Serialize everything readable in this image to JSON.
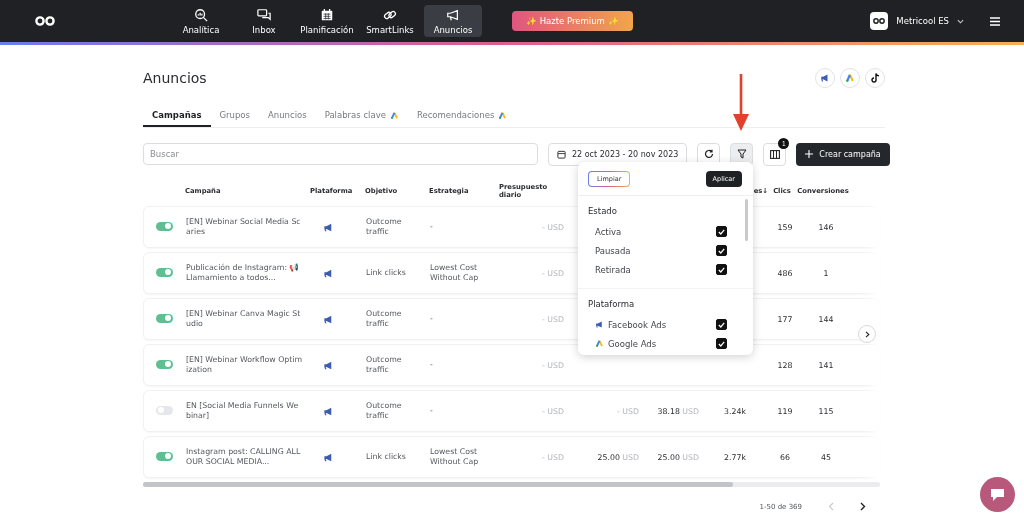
{
  "nav": {
    "items": [
      {
        "label": "Analítica",
        "selected": false
      },
      {
        "label": "Inbox",
        "selected": false
      },
      {
        "label": "Planificación",
        "selected": false
      },
      {
        "label": "SmartLinks",
        "selected": false
      },
      {
        "label": "Anuncios",
        "selected": true
      }
    ],
    "premium_button": "✨ Hazte Premium ✨",
    "account": "Metricool ES"
  },
  "page": {
    "title": "Anuncios"
  },
  "tabs": [
    {
      "label": "Campañas",
      "selected": true,
      "google_badge": false
    },
    {
      "label": "Grupos",
      "selected": false,
      "google_badge": false
    },
    {
      "label": "Anuncios",
      "selected": false,
      "google_badge": false
    },
    {
      "label": "Palabras clave",
      "selected": false,
      "google_badge": true
    },
    {
      "label": "Recomendaciones",
      "selected": false,
      "google_badge": true
    }
  ],
  "toolbar": {
    "search_placeholder": "Buscar",
    "date_range": "22 oct 2023 - 20 nov 2023",
    "columns_badge": "1",
    "create_button": "Crear campaña"
  },
  "table": {
    "columns": {
      "campaign": "Campaña",
      "platform": "Plataforma",
      "objective": "Objetivo",
      "strategy": "Estrategia",
      "daily_budget": "Presupuesto diario",
      "column_9": "es↓",
      "clicks": "Clics",
      "conversions": "Conversiones"
    },
    "rows": [
      {
        "active": true,
        "campaign": "[EN] Webinar Social Media Scaries",
        "objective": "Outcome traffic",
        "strategy": "-",
        "daily_budget": {
          "amount": "-",
          "currency": "USD"
        },
        "clicks": "159",
        "conversions": "146"
      },
      {
        "active": true,
        "campaign": "Publicación de Instagram: 📢 Llamamiento a todos...",
        "objective": "Link clicks",
        "strategy": "Lowest Cost Without Cap",
        "daily_budget": {
          "amount": "-",
          "currency": "USD"
        },
        "clicks": "486",
        "conversions": "1"
      },
      {
        "active": true,
        "campaign": "[EN] Webinar Canva Magic Studio",
        "objective": "Outcome traffic",
        "strategy": "-",
        "daily_budget": {
          "amount": "-",
          "currency": "USD"
        },
        "clicks": "177",
        "conversions": "144"
      },
      {
        "active": true,
        "campaign": "[EN] Webinar Workflow Optimization",
        "objective": "Outcome traffic",
        "strategy": "-",
        "daily_budget": {
          "amount": "-",
          "currency": "USD"
        },
        "clicks": "128",
        "conversions": "141"
      },
      {
        "active": false,
        "campaign": "EN [Social Media Funnels Webinar]",
        "objective": "Outcome traffic",
        "strategy": "-",
        "daily_budget": {
          "amount": "-",
          "currency": "USD"
        },
        "column_7": {
          "amount": "-",
          "currency": "USD"
        },
        "column_8": {
          "amount": "38.18",
          "currency": "USD"
        },
        "column_9": "3.24k",
        "clicks": "119",
        "conversions": "115"
      },
      {
        "active": true,
        "campaign": "Instagram post: CALLING ALL OUR SOCIAL MEDIA...",
        "objective": "Link clicks",
        "strategy": "Lowest Cost Without Cap",
        "daily_budget": {
          "amount": "-",
          "currency": "USD"
        },
        "column_7": {
          "amount": "25.00",
          "currency": "USD"
        },
        "column_8": {
          "amount": "25.00",
          "currency": "USD"
        },
        "column_9": "2.77k",
        "clicks": "66",
        "conversions": "45"
      }
    ]
  },
  "filter_menu": {
    "clear_button": "Limpiar",
    "apply_button": "Aplicar",
    "sections": [
      {
        "kind": "status",
        "title": "Estado",
        "options": [
          {
            "label": "Activa",
            "checked": true
          },
          {
            "label": "Pausada",
            "checked": true
          },
          {
            "label": "Retirada",
            "checked": true
          }
        ]
      },
      {
        "kind": "platform",
        "title": "Plataforma",
        "options": [
          {
            "label": "Facebook Ads",
            "checked": true
          },
          {
            "label": "Google Ads",
            "checked": true
          }
        ]
      }
    ]
  },
  "pagination": {
    "range": "1-50 de 369"
  }
}
